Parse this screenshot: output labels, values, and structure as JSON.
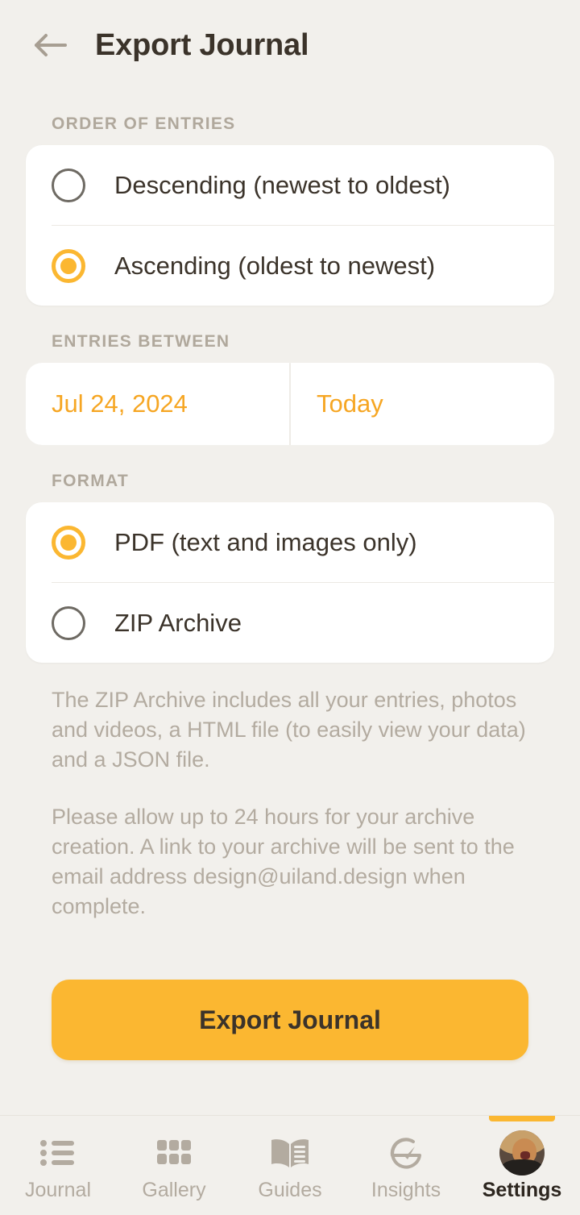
{
  "header": {
    "back_icon": "arrow-left-icon",
    "title": "Export Journal"
  },
  "sections": {
    "order": {
      "label": "ORDER OF ENTRIES",
      "options": [
        {
          "label": "Descending (newest to oldest)",
          "selected": false
        },
        {
          "label": "Ascending (oldest to newest)",
          "selected": true
        }
      ]
    },
    "entries_between": {
      "label": "ENTRIES BETWEEN",
      "start_date": "Jul 24, 2024",
      "end_date": "Today"
    },
    "format": {
      "label": "FORMAT",
      "options": [
        {
          "label": "PDF (text and images only)",
          "selected": true
        },
        {
          "label": "ZIP Archive",
          "selected": false
        }
      ]
    }
  },
  "notes": {
    "zip_info": "The ZIP Archive includes all your entries, photos and videos, a HTML file (to easily view your data) and a JSON file.",
    "delivery_info": "Please allow up to 24 hours for your archive creation. A link to your archive will be sent to the email address design@uiland.design when complete."
  },
  "cta": {
    "label": "Export Journal"
  },
  "tabbar": {
    "items": [
      {
        "label": "Journal",
        "icon": "list-icon",
        "active": false
      },
      {
        "label": "Gallery",
        "icon": "grid-icon",
        "active": false
      },
      {
        "label": "Guides",
        "icon": "open-book-icon",
        "active": false
      },
      {
        "label": "Insights",
        "icon": "speedometer-icon",
        "active": false
      },
      {
        "label": "Settings",
        "icon": "avatar-icon",
        "active": true
      }
    ]
  },
  "colors": {
    "background": "#f2f0ec",
    "card": "#ffffff",
    "accent": "#fbb731",
    "accent_text": "#f6a623",
    "text_primary": "#3b332a",
    "text_muted": "#b3aba0",
    "label_muted": "#b0a89c"
  }
}
